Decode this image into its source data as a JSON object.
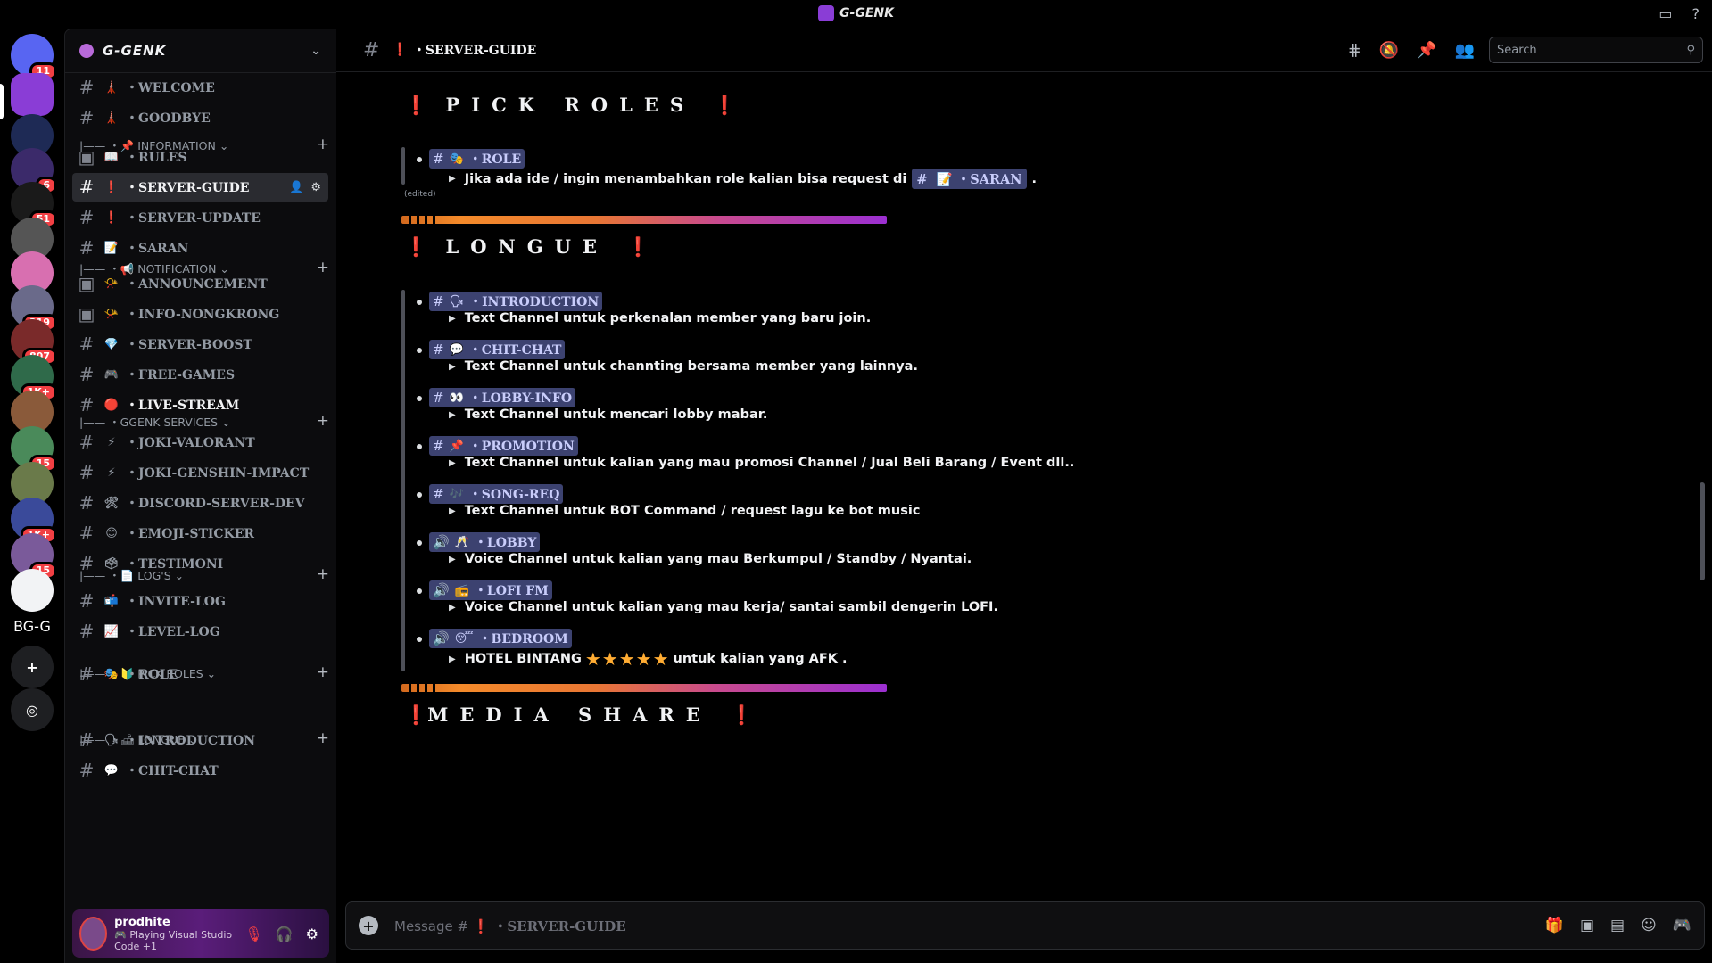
{
  "window": {
    "title": "G-GENK"
  },
  "server": {
    "name": "G-GENK"
  },
  "rail": {
    "servers": [
      {
        "label": "",
        "badge": "11",
        "color": "#5865f2"
      },
      {
        "label": "",
        "badge": "",
        "color": "#8a3dd6"
      },
      {
        "label": "",
        "badge": "",
        "color": "#1e2a55"
      },
      {
        "label": "",
        "badge": "6",
        "color": "#3b2a6a"
      },
      {
        "label": "",
        "badge": "51",
        "color": "#1a1a1a"
      },
      {
        "label": "",
        "badge": "",
        "color": "#555"
      },
      {
        "label": "",
        "badge": "",
        "color": "#d86fb0"
      },
      {
        "label": "",
        "badge": "219",
        "color": "#6a6a8a"
      },
      {
        "label": "",
        "badge": "807",
        "color": "#7a2a2a"
      },
      {
        "label": "",
        "badge": "1K+",
        "color": "#2f6a4a"
      },
      {
        "label": "",
        "badge": "",
        "color": "#8a5a3a"
      },
      {
        "label": "",
        "badge": "15",
        "color": "#4a8a5a"
      },
      {
        "label": "",
        "badge": "",
        "color": "#6a7a4a"
      },
      {
        "label": "",
        "badge": "1K+",
        "color": "#3a4a9a"
      },
      {
        "label": "",
        "badge": "15",
        "color": "#7a5a9a"
      },
      {
        "label": "",
        "badge": "",
        "color": "#f2f3f5"
      },
      {
        "label": "BG-G",
        "badge": "",
        "color": "#000"
      }
    ]
  },
  "channels": {
    "items": [
      {
        "emoji": "🗼",
        "name": "・WELCOME"
      },
      {
        "emoji": "🗼",
        "name": "・GOODBYE"
      },
      {
        "emoji": "📖",
        "name": "・RULES"
      },
      {
        "emoji": "❗",
        "name": "・SERVER-GUIDE"
      },
      {
        "emoji": "❗",
        "name": "・SERVER-UPDATE"
      },
      {
        "emoji": "📝",
        "name": "・SARAN"
      },
      {
        "emoji": "📯",
        "name": "・ANNOUNCEMENT"
      },
      {
        "emoji": "📯",
        "name": "・INFO-NONGKRONG"
      },
      {
        "emoji": "💎",
        "name": "・SERVER-BOOST"
      },
      {
        "emoji": "🎮",
        "name": "・FREE-GAMES"
      },
      {
        "emoji": "🔴",
        "name": "・LIVE-STREAM"
      },
      {
        "emoji": "⚡",
        "name": "・JOKI-VALORANT"
      },
      {
        "emoji": "⚡",
        "name": "・JOKI-GENSHIN-IMPACT"
      },
      {
        "emoji": "🛠",
        "name": "・DISCORD-SERVER-DEV"
      },
      {
        "emoji": "😊",
        "name": "・EMOJI-STICKER"
      },
      {
        "emoji": "🗳",
        "name": "・TESTIMONI"
      },
      {
        "emoji": "📬",
        "name": "・INVITE-LOG"
      },
      {
        "emoji": "📈",
        "name": "・LEVEL-LOG"
      },
      {
        "emoji": "🎭",
        "name": "・ROLE"
      },
      {
        "emoji": "🗣",
        "name": "・INTRODUCTION"
      },
      {
        "emoji": "💬",
        "name": "・CHIT-CHAT"
      }
    ],
    "categories": [
      {
        "label": "|—— ・📌 INFORMATION ⌄"
      },
      {
        "label": "|—— ・📢 NOTIFICATION ⌄"
      },
      {
        "label": "|—— ・GGENK SERVICES ⌄"
      },
      {
        "label": "|—— ・📄 LOG'S ⌄"
      },
      {
        "label": "|—— ・🔰 PICK ROLES ⌄"
      },
      {
        "label": "|—— ・🛋 LONGUE ⌄"
      }
    ]
  },
  "user": {
    "name": "prodhite",
    "status": "🎮 Playing Visual Studio Code +1"
  },
  "header": {
    "channel_emoji": "❗",
    "channel_name": "・SERVER-GUIDE",
    "search_placeholder": "Search"
  },
  "messages": {
    "pick_roles_title": "PICK ROLES",
    "role": {
      "emoji": "🎭",
      "mention": "・ROLE",
      "desc": "Jika ada ide / ingin menambahkan role kalian bisa request di",
      "inline_emoji": "📝",
      "inline_mention": "・SARAN",
      "tail": "."
    },
    "edited": "(edited)",
    "longue_title": "LONGUE",
    "longue": [
      {
        "icon": "#",
        "emoji": "🗣",
        "mention": "・INTRODUCTION",
        "desc": "Text Channel untuk perkenalan member yang baru join."
      },
      {
        "icon": "#",
        "emoji": "💬",
        "mention": "・CHIT-CHAT",
        "desc": "Text Channel untuk channting bersama member yang lainnya."
      },
      {
        "icon": "#",
        "emoji": "👀",
        "mention": "・LOBBY-INFO",
        "desc": "Text Channel untuk mencari lobby mabar."
      },
      {
        "icon": "#",
        "emoji": "📌",
        "mention": "・PROMOTION",
        "desc": "Text Channel untuk kalian yang mau promosi Channel / Jual Beli Barang / Event dll.."
      },
      {
        "icon": "#",
        "emoji": "🎶",
        "mention": "・SONG-REQ",
        "desc": "Text Channel untuk BOT Command /  request lagu ke bot music"
      },
      {
        "icon": "🔊",
        "emoji": "🥂",
        "mention": "・LOBBY",
        "desc": "Voice Channel untuk kalian yang mau Berkumpul / Standby / Nyantai."
      },
      {
        "icon": "🔊",
        "emoji": "📻",
        "mention": "・LOFI FM",
        "desc": "Voice Channel untuk kalian yang mau kerja/ santai sambil dengerin LOFI."
      },
      {
        "icon": "🔊",
        "emoji": "😴",
        "mention": "・BEDROOM",
        "desc": "HOTEL BINTANG",
        "stars": "★★★★★",
        "tail": "untuk kalian yang AFK ."
      }
    ],
    "media_title": "MEDIA SHARE"
  },
  "composer": {
    "placeholder_prefix": "Message #",
    "emoji": "❗",
    "channel": "・SERVER-GUIDE"
  },
  "colors": {
    "accent": "#5865f2",
    "mention_bg": "#3c4270",
    "mention_text": "#c9cdfb",
    "title_bang": "#c061cb"
  }
}
